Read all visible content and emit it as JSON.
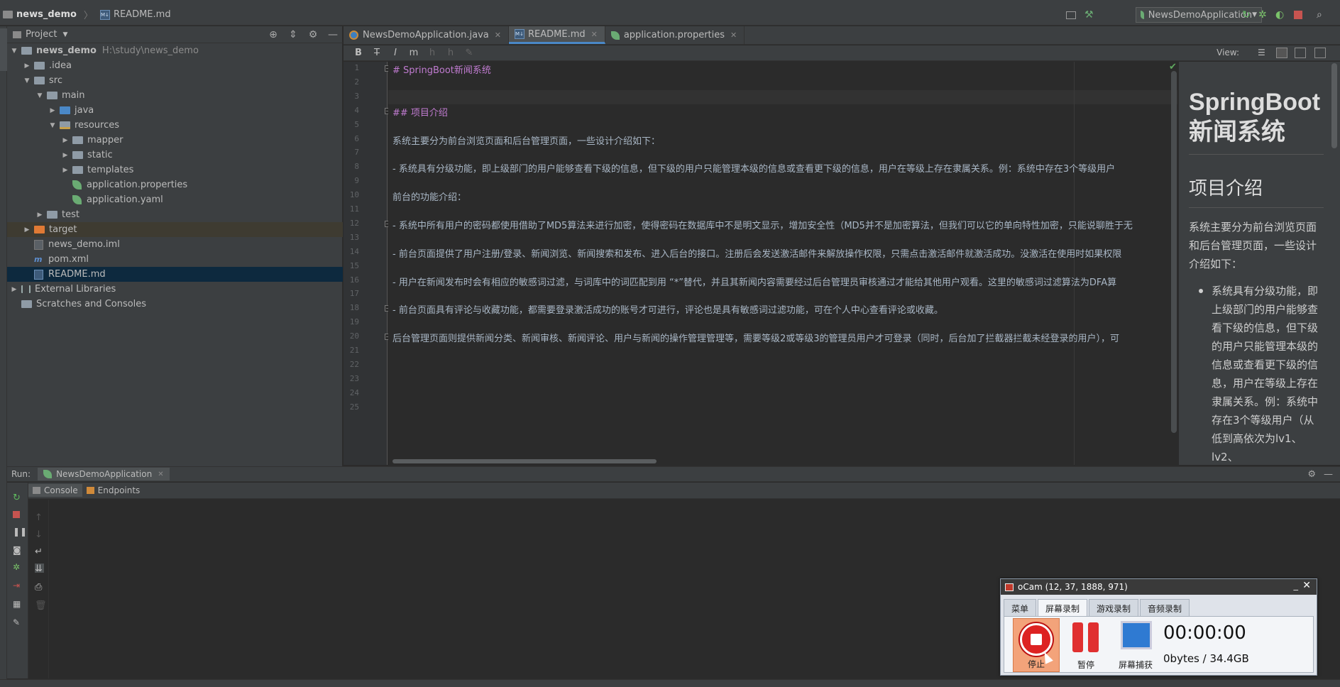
{
  "navbar": {
    "project_name": "news_demo",
    "current_file": "README.md",
    "run_config": "NewsDemoApplication"
  },
  "project_panel": {
    "title": "Project",
    "tree": [
      {
        "label": "news_demo",
        "path": "H:\\study\\news_demo",
        "depth": 0,
        "expanded": true,
        "kind": "root"
      },
      {
        "label": ".idea",
        "depth": 1,
        "expanded": false,
        "kind": "folder"
      },
      {
        "label": "src",
        "depth": 1,
        "expanded": true,
        "kind": "folder"
      },
      {
        "label": "main",
        "depth": 2,
        "expanded": true,
        "kind": "folder"
      },
      {
        "label": "java",
        "depth": 3,
        "expanded": false,
        "kind": "folder-blue"
      },
      {
        "label": "resources",
        "depth": 3,
        "expanded": true,
        "kind": "folder-res"
      },
      {
        "label": "mapper",
        "depth": 4,
        "expanded": false,
        "kind": "folder"
      },
      {
        "label": "static",
        "depth": 4,
        "expanded": false,
        "kind": "folder"
      },
      {
        "label": "templates",
        "depth": 4,
        "expanded": false,
        "kind": "folder"
      },
      {
        "label": "application.properties",
        "depth": 4,
        "kind": "spring-file"
      },
      {
        "label": "application.yaml",
        "depth": 4,
        "kind": "spring-file"
      },
      {
        "label": "test",
        "depth": 2,
        "expanded": false,
        "kind": "folder"
      },
      {
        "label": "target",
        "depth": 1,
        "expanded": false,
        "kind": "folder-orange"
      },
      {
        "label": "news_demo.iml",
        "depth": 1,
        "kind": "iml-file"
      },
      {
        "label": "pom.xml",
        "depth": 1,
        "kind": "pom-file"
      },
      {
        "label": "README.md",
        "depth": 1,
        "kind": "md-file"
      },
      {
        "label": "External Libraries",
        "depth": 0,
        "expanded": false,
        "kind": "lib"
      },
      {
        "label": "Scratches and Consoles",
        "depth": 0,
        "kind": "scratch"
      }
    ]
  },
  "editor_tabs": [
    {
      "label": "NewsDemoApplication.java",
      "active": false,
      "icon": "java-class-icon"
    },
    {
      "label": "README.md",
      "active": true,
      "icon": "markdown-icon"
    },
    {
      "label": "application.properties",
      "active": false,
      "icon": "spring-icon"
    }
  ],
  "md_toolbar": {
    "buttons": [
      "B",
      "T",
      "I",
      "m",
      "h",
      "h",
      "✎"
    ],
    "view_label": "View:"
  },
  "editor": {
    "line_numbers": [
      "1",
      "2",
      "3",
      "4",
      "5",
      "6",
      "7",
      "8",
      "9",
      "10",
      "11",
      "12",
      "13",
      "14",
      "15",
      "16",
      "17",
      "18",
      "19",
      "20",
      "21",
      "22",
      "23",
      "24",
      "25"
    ],
    "lines": [
      {
        "line": 1,
        "text": "# SpringBoot新闻系统",
        "heading": true
      },
      {
        "line": 4,
        "text": "## 项目介绍",
        "heading": true
      },
      {
        "line": 6,
        "text": "系统主要分为前台浏览页面和后台管理页面，一些设计介绍如下："
      },
      {
        "line": 8,
        "text": "- 系统具有分级功能，即上级部门的用户能够查看下级的信息，但下级的用户只能管理本级的信息或查看更下级的信息，用户在等级上存在隶属关系。例：系统中存在3个等级用户"
      },
      {
        "line": 10,
        "text": "前台的功能介绍："
      },
      {
        "line": 12,
        "text": "- 系统中所有用户的密码都使用借助了MD5算法来进行加密，使得密码在数据库中不是明文显示，增加安全性（MD5并不是加密算法，但我们可以它的单向特性加密，只能说聊胜于无"
      },
      {
        "line": 14,
        "text": "- 前台页面提供了用户注册/登录、新闻浏览、新闻搜索和发布、进入后台的接口。注册后会发送激活邮件来解放操作权限，只需点击激活邮件就激活成功。没激活在使用时如果权限"
      },
      {
        "line": 16,
        "text": "- 用户在新闻发布时会有相应的敏感词过滤，与词库中的词匹配到用 “*”替代，并且其新闻内容需要经过后台管理员审核通过才能给其他用户观看。这里的敏感词过滤算法为DFA算"
      },
      {
        "line": 18,
        "text": "- 前台页面具有评论与收藏功能，都需要登录激活成功的账号才可进行，评论也是具有敏感词过滤功能，可在个人中心查看评论或收藏。"
      },
      {
        "line": 20,
        "text": "后台管理页面则提供新闻分类、新闻审核、新闻评论、用户与新闻的操作管理管理等，需要等级2或等级3的管理员用户才可登录（同时，后台加了拦截器拦截未经登录的用户），可"
      }
    ]
  },
  "preview": {
    "h1": "SpringBoot新闻系统",
    "h2": "项目介绍",
    "p": "系统主要分为前台浏览页面和后台管理页面，一些设计介绍如下：",
    "li": "系统具有分级功能，即上级部门的用户能够查看下级的信息，但下级的用户只能管理本级的信息或查看更下级的信息，用户在等级上存在隶属关系。例：系统中存在3个等级用户（从低到高依次为lv1、lv2、"
  },
  "run_panel": {
    "label": "Run:",
    "tab": "NewsDemoApplication",
    "subtabs": [
      "Console",
      "Endpoints"
    ]
  },
  "ocam": {
    "title": "oCam (12, 37, 1888, 971)",
    "tabs": [
      "菜单",
      "屏幕录制",
      "游戏录制",
      "音频录制"
    ],
    "active_tab": "屏幕录制",
    "buttons": {
      "stop": "停止",
      "pause": "暂停",
      "capture": "屏幕捕获"
    },
    "timer": "00:00:00",
    "size": "0bytes / 34.4GB"
  }
}
